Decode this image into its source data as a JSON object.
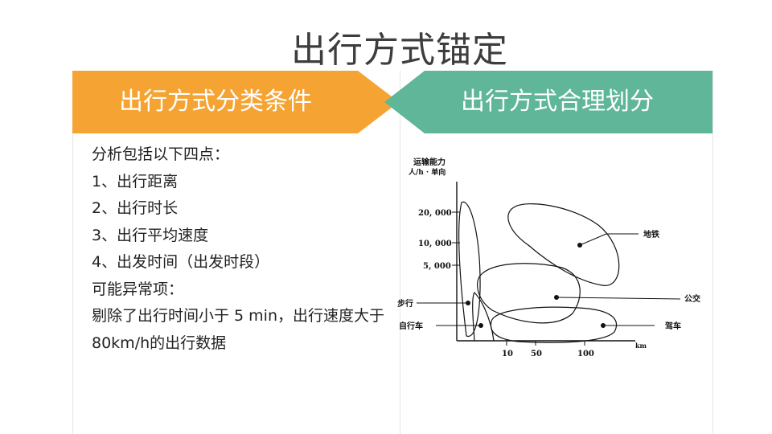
{
  "slide": {
    "title": "出行方式锚定"
  },
  "left_banner": {
    "label": "出行方式分类条件",
    "color": "#f5a433"
  },
  "right_banner": {
    "label": "出行方式合理划分",
    "color": "#5fb698"
  },
  "left_panel": {
    "lines": [
      "分析包括以下四点：",
      "1、出行距离",
      "2、出行时长",
      "3、出行平均速度",
      "4、出发时间（出发时段）",
      "可能异常项：",
      "剔除了出行时间小于 5 min，出行速度大于80km/h的出行数据"
    ]
  },
  "diagram": {
    "y_axis_title_1": "运输能力",
    "y_axis_title_2": "人/h · 单向",
    "x_axis_unit": "km",
    "y_ticks": [
      "20, 000",
      "10, 000",
      "5, 000"
    ],
    "x_ticks": [
      "10",
      "50",
      "100"
    ],
    "modes": {
      "metro": "地铁",
      "bus": "公交",
      "walk": "步行",
      "bicycle": "自行车",
      "car": "驾车"
    }
  }
}
